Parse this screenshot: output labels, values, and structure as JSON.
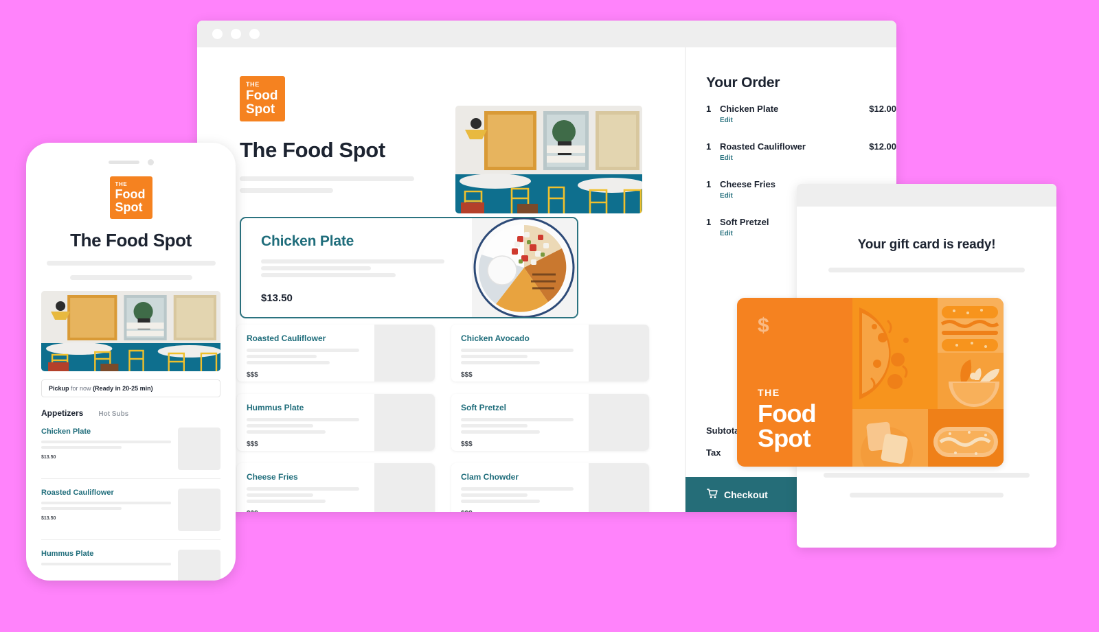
{
  "background_color": "#ff83fb",
  "brand": {
    "the": "THE",
    "word1": "Food",
    "word2": "Spot",
    "logo_color": "#f58220",
    "accent_teal": "#1f6d7b",
    "checkout_teal": "#256d78"
  },
  "browser": {
    "shop_title": "The Food Spot",
    "featured": {
      "name": "Chicken Plate",
      "price": "$13.50"
    },
    "menu_items": [
      {
        "name": "Roasted Cauliflower",
        "price": "$$$"
      },
      {
        "name": "Chicken Avocado",
        "price": "$$$"
      },
      {
        "name": "Hummus Plate",
        "price": "$$$"
      },
      {
        "name": "Soft Pretzel",
        "price": "$$$"
      },
      {
        "name": "Cheese Fries",
        "price": "$$$"
      },
      {
        "name": "Clam Chowder",
        "price": "$$$"
      }
    ],
    "order": {
      "title": "Your Order",
      "edit_label": "Edit",
      "items": [
        {
          "qty": "1",
          "name": "Chicken Plate",
          "price": "$12.00"
        },
        {
          "qty": "1",
          "name": "Roasted Cauliflower",
          "price": "$12.00"
        },
        {
          "qty": "1",
          "name": "Cheese Fries",
          "price": ""
        },
        {
          "qty": "1",
          "name": "Soft Pretzel",
          "price": ""
        }
      ],
      "subtotal_label": "Subtotal",
      "tax_label": "Tax",
      "checkout_label": "Checkout"
    }
  },
  "phone": {
    "shop_title": "The Food Spot",
    "pickup_mode": "Pickup",
    "pickup_rest": "for now",
    "pickup_ready": "(Ready in 20-25 min)",
    "tab_active": "Appetizers",
    "tab_idle": "Hot Subs",
    "items": [
      {
        "name": "Chicken Plate",
        "price": "$13.50"
      },
      {
        "name": "Roasted Cauliflower",
        "price": "$13.50"
      },
      {
        "name": "Hummus Plate",
        "price": ""
      }
    ]
  },
  "gift": {
    "title": "Your gift card is ready!",
    "card_the": "THE",
    "card_word1": "Food",
    "card_word2": "Spot",
    "card_symbol": "$"
  }
}
